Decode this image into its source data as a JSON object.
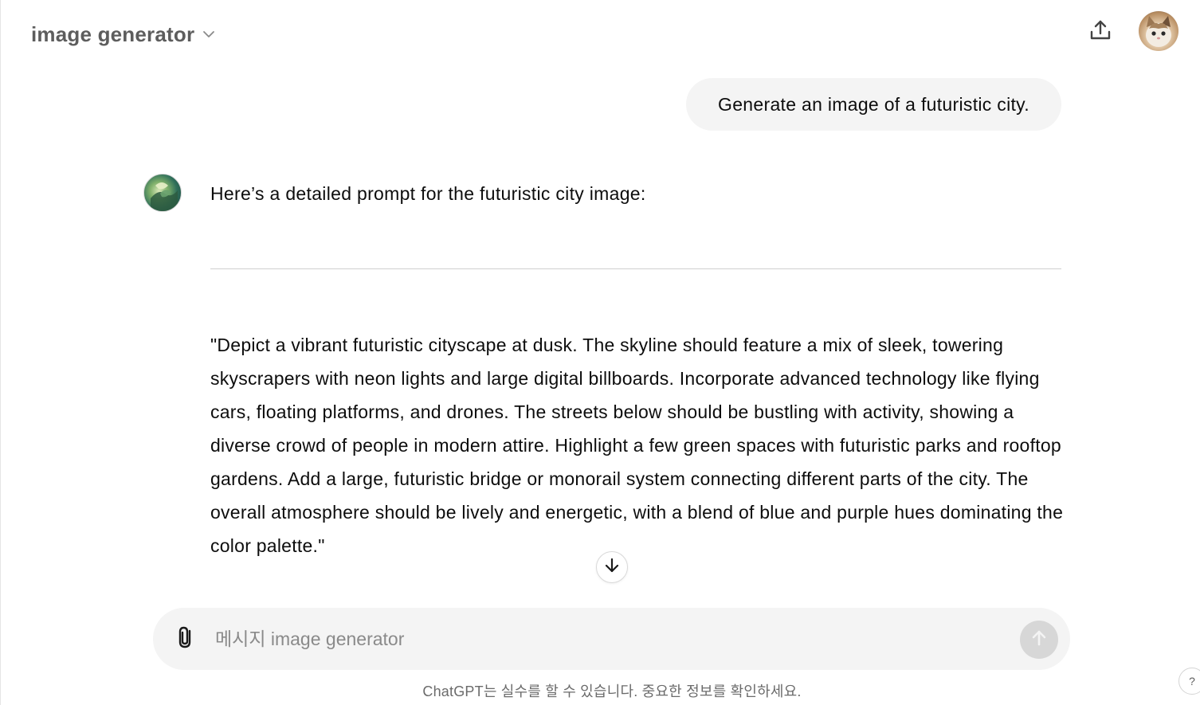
{
  "header": {
    "model_title": "image generator",
    "icons": {
      "chevron": "chevron-down-icon",
      "share": "share-upload-icon",
      "avatar": "user-avatar-cat"
    }
  },
  "conversation": {
    "user_message": "Generate an image of a futuristic city.",
    "assistant_intro": "Here’s a detailed prompt for the futuristic city image:",
    "assistant_prompt": "\"Depict a vibrant futuristic cityscape at dusk. The skyline should feature a mix of sleek, towering skyscrapers with neon lights and large digital billboards. Incorporate advanced technology like flying cars, floating platforms, and drones. The streets below should be bustling with activity, showing a diverse crowd of people in modern attire. Highlight a few green spaces with futuristic parks and rooftop gardens. Add a large, futuristic bridge or monorail system connecting different parts of the city. The overall atmosphere should be lively and energetic, with a blend of blue and purple hues dominating the color palette.\""
  },
  "composer": {
    "placeholder": "메시지 image generator",
    "icons": {
      "attach": "paperclip-icon",
      "send": "arrow-up-icon",
      "scroll": "arrow-down-icon"
    }
  },
  "footer": {
    "disclaimer": "ChatGPT는 실수를 할 수 있습니다. 중요한 정보를 확인하세요.",
    "help_label": "?"
  },
  "colors": {
    "bubble_bg": "#f4f4f4",
    "send_disabled": "#d7d7d7",
    "muted_text": "#6b6b6b"
  }
}
